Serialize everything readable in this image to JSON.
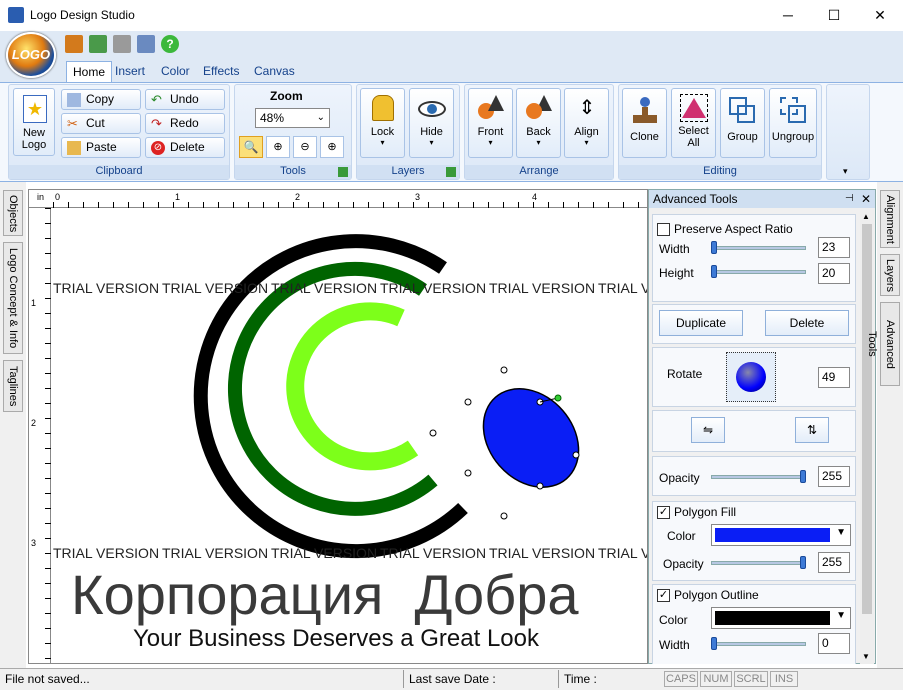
{
  "window": {
    "title": "Logo Design Studio",
    "minimize": "─",
    "maximize": "☐",
    "close": "✕"
  },
  "app_orb": "LOGO",
  "tabs": [
    {
      "label": "Home"
    },
    {
      "label": "Insert"
    },
    {
      "label": "Color"
    },
    {
      "label": "Effects"
    },
    {
      "label": "Canvas"
    }
  ],
  "ribbon": {
    "new_logo": "New Logo",
    "clipboard": {
      "copy": "Copy",
      "cut": "Cut",
      "paste": "Paste",
      "undo": "Undo",
      "redo": "Redo",
      "delete": "Delete",
      "label": "Clipboard"
    },
    "tools": {
      "zoom_label": "Zoom",
      "zoom_value": "48%",
      "label": "Tools"
    },
    "layers": {
      "lock": "Lock",
      "hide": "Hide",
      "label": "Layers"
    },
    "arrange": {
      "front": "Front",
      "back": "Back",
      "align": "Align",
      "label": "Arrange"
    },
    "editing": {
      "clone": "Clone",
      "select_all": "Select All",
      "group": "Group",
      "ungroup": "Ungroup",
      "label": "Editing"
    }
  },
  "left_tabs": [
    "Objects",
    "Logo Concept & Info",
    "Taglines"
  ],
  "right_tabs": [
    "Alignment",
    "Layers",
    "Advanced Tools"
  ],
  "ruler": {
    "unit": "in",
    "h": [
      "0",
      "1",
      "2",
      "3",
      "4"
    ],
    "v": [
      "1",
      "2",
      "3"
    ]
  },
  "canvas": {
    "trial_text": "TRIAL VERSION",
    "company": "Корпорация  Добра",
    "tagline": "Your Business Deserves a Great Look",
    "colors": {
      "outer_arc": "#000000",
      "middle_arc": "#006400",
      "inner_arc": "#7dff1a",
      "ellipse": "#0a1ef5"
    }
  },
  "panel": {
    "title": "Advanced Tools",
    "pin": "📌",
    "close": "✕",
    "preserve_aspect": "Preserve Aspect Ratio",
    "preserve_checked": false,
    "width_label": "Width",
    "width_value": "23",
    "height_label": "Height",
    "height_value": "20",
    "duplicate": "Duplicate",
    "delete": "Delete",
    "rotate_label": "Rotate",
    "rotate_value": "49",
    "opacity_label": "Opacity",
    "opacity_value": "255",
    "polygon_fill": "Polygon Fill",
    "fill_checked": true,
    "fill_color_label": "Color",
    "fill_color": "#0a1ef5",
    "fill_opacity_label": "Opacity",
    "fill_opacity_value": "255",
    "polygon_outline": "Polygon Outline",
    "outline_checked": true,
    "outline_color_label": "Color",
    "outline_color": "#000000",
    "outline_width_label": "Width",
    "outline_width_value": "0"
  },
  "status": {
    "file": "File not saved...",
    "last_save": "Last save Date :",
    "time": "Time :",
    "caps": "CAPS",
    "num": "NUM",
    "scrl": "SCRL",
    "ins": "INS"
  }
}
